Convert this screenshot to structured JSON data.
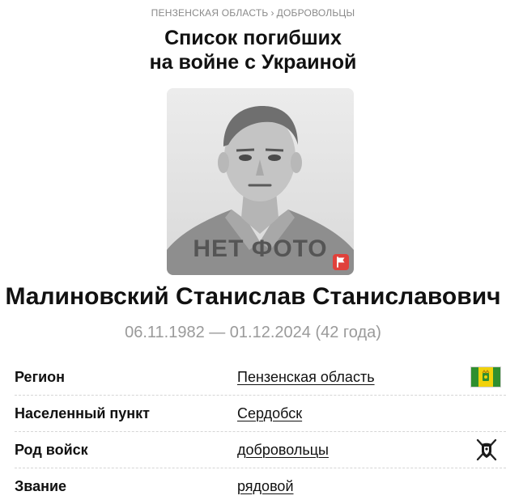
{
  "breadcrumb": {
    "region": "ПЕНЗЕНСКАЯ ОБЛАСТЬ",
    "separator": "›",
    "category": "ДОБРОВОЛЬЦЫ"
  },
  "title": {
    "line1": "Список погибших",
    "line2": "на войне с Украиной"
  },
  "photo": {
    "placeholder_text": "НЕТ ФОТО",
    "badge_icon": "flag-icon",
    "badge_color": "#e0413b"
  },
  "person": {
    "name": "Малиновский Станислав Станиславович",
    "dates": "06.11.1982 — 01.12.2024 (42 года)"
  },
  "details": [
    {
      "label": "Регион",
      "value": "Пензенская область",
      "icon": "region-flag-icon"
    },
    {
      "label": "Населенный пункт",
      "value": "Сердобск",
      "icon": ""
    },
    {
      "label": "Род войск",
      "value": "добровольцы",
      "icon": "volunteer-emblem-icon"
    },
    {
      "label": "Звание",
      "value": "рядовой",
      "icon": ""
    }
  ],
  "colors": {
    "muted_text": "#9a9a9a",
    "region_flag_green": "#2f8f2f",
    "region_flag_yellow": "#f1d20b"
  }
}
